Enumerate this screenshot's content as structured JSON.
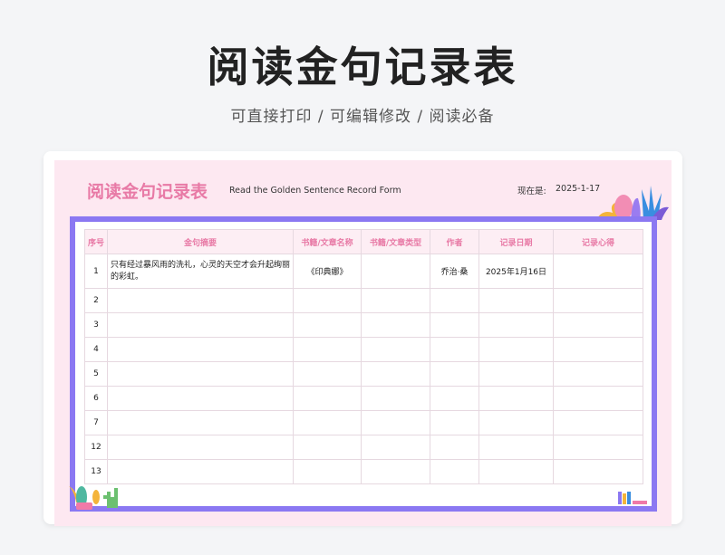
{
  "header": {
    "title": "阅读金句记录表",
    "subtitle": "可直接打印 /  可编辑修改  / 阅读必备"
  },
  "sheet": {
    "title": "阅读金句记录表",
    "subtitle_en": "Read the Golden Sentence Record Form",
    "date_label": "现在是:",
    "date_value": "2025-1-17"
  },
  "table": {
    "columns": [
      "序号",
      "金句摘要",
      "书籍/文章名称",
      "书籍/文章类型",
      "作者",
      "记录日期",
      "记录心得"
    ],
    "rows": [
      {
        "no": "1",
        "excerpt": "只有经过暴风雨的洗礼，心灵的天空才会升起绚丽的彩虹。",
        "book": "《印典娜》",
        "type": "",
        "author": "乔治·桑",
        "date": "2025年1月16日",
        "notes": ""
      },
      {
        "no": "2",
        "excerpt": "",
        "book": "",
        "type": "",
        "author": "",
        "date": "",
        "notes": ""
      },
      {
        "no": "3",
        "excerpt": "",
        "book": "",
        "type": "",
        "author": "",
        "date": "",
        "notes": ""
      },
      {
        "no": "4",
        "excerpt": "",
        "book": "",
        "type": "",
        "author": "",
        "date": "",
        "notes": ""
      },
      {
        "no": "5",
        "excerpt": "",
        "book": "",
        "type": "",
        "author": "",
        "date": "",
        "notes": ""
      },
      {
        "no": "6",
        "excerpt": "",
        "book": "",
        "type": "",
        "author": "",
        "date": "",
        "notes": ""
      },
      {
        "no": "7",
        "excerpt": "",
        "book": "",
        "type": "",
        "author": "",
        "date": "",
        "notes": ""
      },
      {
        "no": "12",
        "excerpt": "",
        "book": "",
        "type": "",
        "author": "",
        "date": "",
        "notes": ""
      },
      {
        "no": "13",
        "excerpt": "",
        "book": "",
        "type": "",
        "author": "",
        "date": "",
        "notes": ""
      }
    ]
  },
  "colors": {
    "accent_pink": "#e87aa6",
    "frame_purple": "#8b78f2",
    "sheet_bg": "#fde8f1"
  },
  "icons": [
    "plants-decoration-icon",
    "cactus-decoration-icon",
    "books-decoration-icon"
  ]
}
